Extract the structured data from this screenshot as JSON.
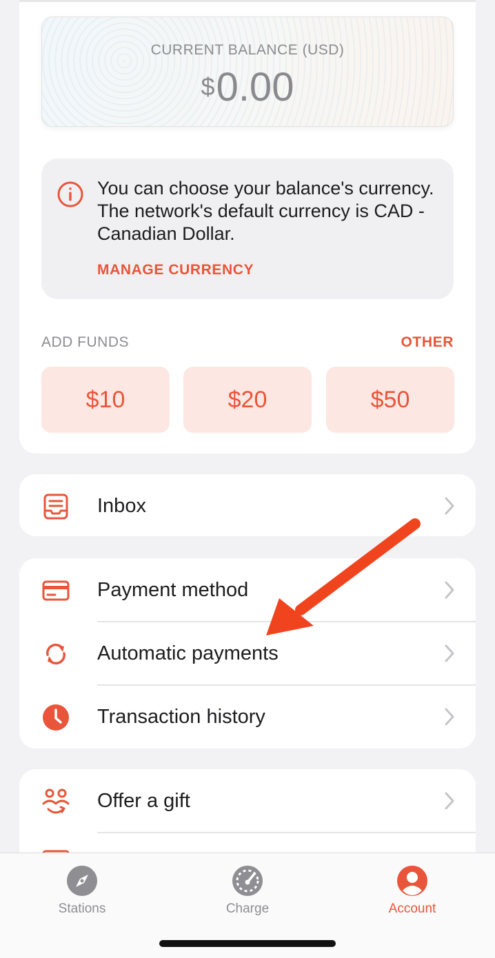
{
  "balance": {
    "label": "CURRENT BALANCE (USD)",
    "currency_symbol": "$",
    "amount": "0.00"
  },
  "notice": {
    "icon": "info-circle-icon",
    "text": "You can choose your balance's currency. The network's default currency is CAD - Canadian Dollar.",
    "action_label": "MANAGE CURRENCY"
  },
  "add_funds": {
    "label": "ADD FUNDS",
    "other_label": "OTHER",
    "amounts": [
      "$10",
      "$20",
      "$50"
    ]
  },
  "menu": {
    "inbox": {
      "label": "Inbox",
      "icon": "inbox-tray-icon"
    },
    "payment_method": {
      "label": "Payment method",
      "icon": "credit-card-icon"
    },
    "automatic_payments": {
      "label": "Automatic payments",
      "icon": "refresh-cycle-icon"
    },
    "transaction_history": {
      "label": "Transaction history",
      "icon": "clock-icon"
    },
    "offer_gift": {
      "label": "Offer a gift",
      "icon": "people-gift-icon"
    }
  },
  "tabs": [
    {
      "label": "Stations",
      "icon": "compass-icon",
      "active": false
    },
    {
      "label": "Charge",
      "icon": "speedometer-icon",
      "active": false
    },
    {
      "label": "Account",
      "icon": "user-icon",
      "active": true
    }
  ],
  "colors": {
    "accent": "#e8553a",
    "accent_light": "#fde7e2",
    "annotation_arrow": "#f0441f",
    "tab_inactive": "#8e8e93"
  }
}
